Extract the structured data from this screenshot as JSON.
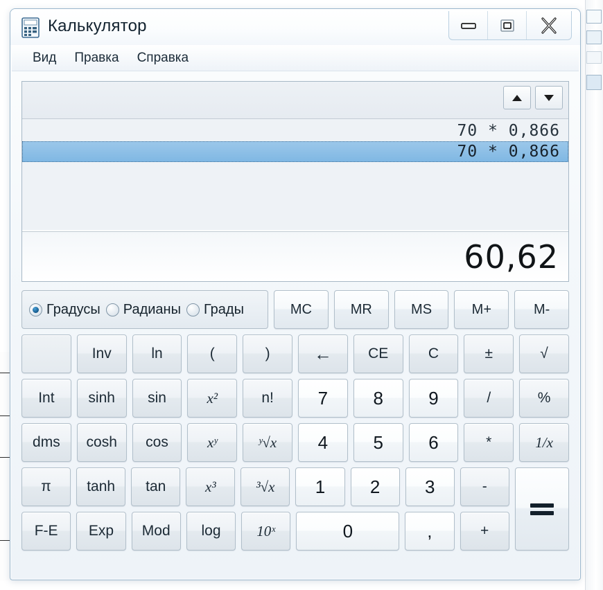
{
  "window": {
    "title": "Калькулятор",
    "icon": "calculator-icon",
    "controls": {
      "minimize": "minimize-icon",
      "maximize": "maximize-icon",
      "close": "close-icon"
    }
  },
  "menu": {
    "items": [
      {
        "label": "Вид"
      },
      {
        "label": "Правка"
      },
      {
        "label": "Справка"
      }
    ]
  },
  "display": {
    "history": [
      {
        "text": "70 * 0,866",
        "selected": false
      },
      {
        "text": "70 * 0,866",
        "selected": true
      }
    ],
    "result": "60,62",
    "scroll_up": "▲",
    "scroll_down": "▼"
  },
  "angle_mode": {
    "options": [
      {
        "label": "Градусы",
        "checked": true
      },
      {
        "label": "Радианы",
        "checked": false
      },
      {
        "label": "Грады",
        "checked": false
      }
    ]
  },
  "memory_buttons": [
    {
      "label": "MC"
    },
    {
      "label": "MR"
    },
    {
      "label": "MS"
    },
    {
      "label": "M+"
    },
    {
      "label": "M-"
    }
  ],
  "keypad": {
    "row1": [
      {
        "label": "",
        "kind": "blank",
        "name": "blank-button"
      },
      {
        "label": "Inv",
        "kind": "func",
        "name": "inv-button"
      },
      {
        "label": "ln",
        "kind": "func",
        "name": "ln-button"
      },
      {
        "label": "(",
        "kind": "func",
        "name": "open-paren-button"
      },
      {
        "label": ")",
        "kind": "func",
        "name": "close-paren-button"
      },
      {
        "label": "←",
        "kind": "func",
        "name": "backspace-button"
      },
      {
        "label": "CE",
        "kind": "func",
        "name": "clear-entry-button"
      },
      {
        "label": "C",
        "kind": "func",
        "name": "clear-button"
      },
      {
        "label": "±",
        "kind": "func",
        "name": "sign-toggle-button"
      },
      {
        "label": "√",
        "kind": "func",
        "name": "sqrt-button"
      }
    ],
    "row2": [
      {
        "label": "Int",
        "kind": "func",
        "name": "int-button"
      },
      {
        "label": "sinh",
        "kind": "func",
        "name": "sinh-button"
      },
      {
        "label": "sin",
        "kind": "func",
        "name": "sin-button"
      },
      {
        "label": "x²",
        "kind": "func",
        "name": "x-squared-button"
      },
      {
        "label": "n!",
        "kind": "func",
        "name": "factorial-button"
      },
      {
        "label": "7",
        "kind": "num",
        "name": "digit-7-button"
      },
      {
        "label": "8",
        "kind": "num",
        "name": "digit-8-button"
      },
      {
        "label": "9",
        "kind": "num",
        "name": "digit-9-button"
      },
      {
        "label": "/",
        "kind": "func",
        "name": "divide-button"
      },
      {
        "label": "%",
        "kind": "func",
        "name": "percent-button"
      }
    ],
    "row3": [
      {
        "label": "dms",
        "kind": "func",
        "name": "dms-button"
      },
      {
        "label": "cosh",
        "kind": "func",
        "name": "cosh-button"
      },
      {
        "label": "cos",
        "kind": "func",
        "name": "cos-button"
      },
      {
        "label": "xʸ",
        "kind": "func",
        "name": "x-power-y-button"
      },
      {
        "label": "ʸ√x",
        "kind": "func",
        "name": "y-root-x-button"
      },
      {
        "label": "4",
        "kind": "num",
        "name": "digit-4-button"
      },
      {
        "label": "5",
        "kind": "num",
        "name": "digit-5-button"
      },
      {
        "label": "6",
        "kind": "num",
        "name": "digit-6-button"
      },
      {
        "label": "*",
        "kind": "func",
        "name": "multiply-button"
      },
      {
        "label": "1/x",
        "kind": "func",
        "name": "reciprocal-button"
      }
    ],
    "row4": [
      {
        "label": "π",
        "kind": "func",
        "name": "pi-button"
      },
      {
        "label": "tanh",
        "kind": "func",
        "name": "tanh-button"
      },
      {
        "label": "tan",
        "kind": "func",
        "name": "tan-button"
      },
      {
        "label": "x³",
        "kind": "func",
        "name": "x-cubed-button"
      },
      {
        "label": "³√x",
        "kind": "func",
        "name": "cube-root-button"
      },
      {
        "label": "1",
        "kind": "num",
        "name": "digit-1-button"
      },
      {
        "label": "2",
        "kind": "num",
        "name": "digit-2-button"
      },
      {
        "label": "3",
        "kind": "num",
        "name": "digit-3-button"
      },
      {
        "label": "-",
        "kind": "func",
        "name": "subtract-button"
      }
    ],
    "row5": [
      {
        "label": "F-E",
        "kind": "func",
        "name": "f-e-button"
      },
      {
        "label": "Exp",
        "kind": "func",
        "name": "exp-button"
      },
      {
        "label": "Mod",
        "kind": "func",
        "name": "mod-button"
      },
      {
        "label": "log",
        "kind": "func",
        "name": "log-button"
      },
      {
        "label": "10ˣ",
        "kind": "func",
        "name": "ten-power-x-button"
      },
      {
        "label": "0",
        "kind": "num wide0",
        "name": "digit-0-button"
      },
      {
        "label": ",",
        "kind": "num",
        "name": "decimal-separator-button"
      },
      {
        "label": "+",
        "kind": "func",
        "name": "add-button"
      }
    ],
    "equals": {
      "label": "=",
      "name": "equals-button"
    }
  },
  "colors": {
    "window_border": "#9bb7cd",
    "selection": "#7fb7e3",
    "button_face": "#eef2f6",
    "text": "#1c2a35"
  }
}
